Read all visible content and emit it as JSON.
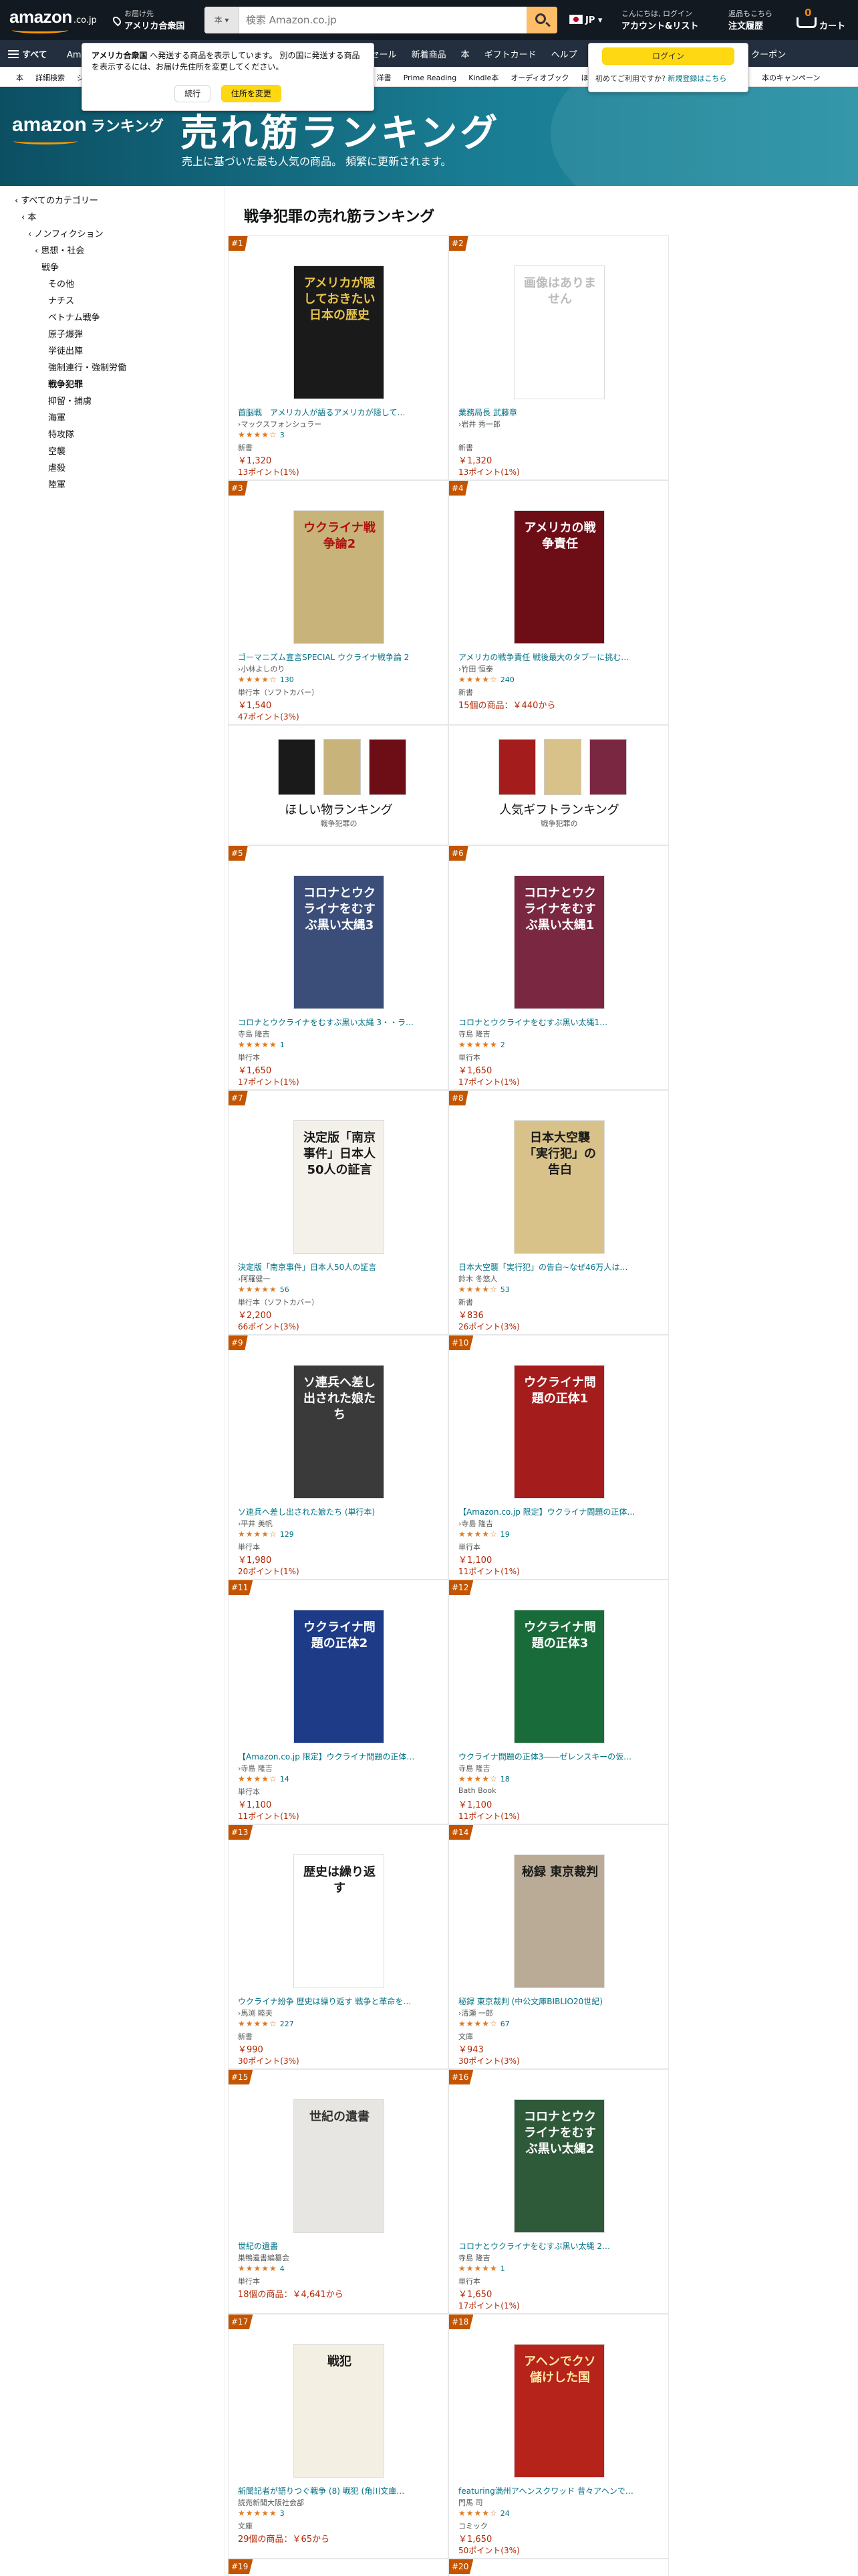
{
  "nav": {
    "logo": "amazon",
    "tld": ".co.jp",
    "deliver_line1": "お届け先",
    "deliver_line2": "アメリカ合衆国",
    "search_category": "本",
    "search_placeholder": "検索 Amazon.co.jp",
    "lang": "JP",
    "account_line1": "こんにちは, ログイン",
    "account_line2": "アカウント&リスト",
    "orders_line1": "返品もこちら",
    "orders_line2": "注文履歴",
    "cart_count": "0",
    "cart_label": "カート"
  },
  "subnav": {
    "all_label": "すべて",
    "links": [
      "Amazonファッション",
      "Prime Video",
      "ベストセラー",
      "Basics",
      "タイムセール",
      "新着商品",
      "本",
      "ギフトカード",
      "ヘルプ",
      "カスタマーサービス",
      "ミュージック",
      "クーポン"
    ]
  },
  "catnav": {
    "items": [
      "本",
      "詳細検索",
      "ジャンル一覧",
      "新刊・予約",
      "Amazonランキング",
      "コミック",
      "雑誌",
      "文庫・新書",
      "洋書",
      "Prime Reading",
      "Kindle本",
      "オーディオブック",
      "ほしい物リスト"
    ],
    "right": "本のキャンペーン"
  },
  "popover": {
    "msg_bold": "アメリカ合衆国",
    "msg_rest": " へ発送する商品を表示しています。 別の国に発送する商品を表示するには、お届け先住所を変更してください。",
    "keep_label": "続行",
    "change_label": "住所を変更"
  },
  "login_popover": {
    "button": "ログイン",
    "hint_text": "初めてご利用ですか? ",
    "hint_link": "新規登録はこちら"
  },
  "banner": {
    "logo": "amazon",
    "ranking_word": "ランキング",
    "title": "売れ筋ランキング",
    "subtitle": "売上に基づいた最も人気の商品。 頻繁に更新されます。"
  },
  "sidebar": {
    "items": [
      {
        "label": "‹ すべてのカテゴリー",
        "level": 0
      },
      {
        "label": "‹ 本",
        "level": 1
      },
      {
        "label": "‹ ノンフィクション",
        "level": 2
      },
      {
        "label": "‹ 思想・社会",
        "level": 3
      },
      {
        "label": "戦争",
        "level": 4
      },
      {
        "label": "その他",
        "level": 5
      },
      {
        "label": "ナチス",
        "level": 5
      },
      {
        "label": "ベトナム戦争",
        "level": 5
      },
      {
        "label": "原子爆弾",
        "level": 5
      },
      {
        "label": "学徒出陣",
        "level": 5
      },
      {
        "label": "強制連行・強制労働",
        "level": 5
      },
      {
        "label": "戦争犯罪",
        "level": 5,
        "selected": true
      },
      {
        "label": "抑留・捕虜",
        "level": 5
      },
      {
        "label": "海軍",
        "level": 5
      },
      {
        "label": "特攻隊",
        "level": 5
      },
      {
        "label": "空襲",
        "level": 5
      },
      {
        "label": "虐殺",
        "level": 5
      },
      {
        "label": "陸軍",
        "level": 5
      }
    ]
  },
  "page_title": "戦争犯罪の売れ筋ランキング",
  "products": [
    {
      "rank": "#1",
      "title": "首脳戦　アメリカ人が語るアメリカが隠して…",
      "author": "›マックスフォンシュラー",
      "stars": "★★★★☆",
      "reviews": "3",
      "format": "新書",
      "price": "￥1,320",
      "points": "13ポイント(1%)",
      "cover_bg": "#1a1a1a",
      "cover_text": "アメリカが隠しておきたい日本の歴史",
      "cover_fg": "#e8c24a"
    },
    {
      "rank": "#2",
      "title": "業務局長 武藤章",
      "author": "›岩井 秀一郎",
      "stars": "",
      "reviews": "",
      "format": "新書",
      "price": "￥1,320",
      "points": "13ポイント(1%)",
      "cover_bg": "#ffffff",
      "cover_text": "画像はありません",
      "cover_fg": "#bbbbbb"
    },
    {
      "rank": "#3",
      "title": "ゴーマニズム宣言SPECIAL ウクライナ戦争論 2",
      "author": "›小林よしのり",
      "stars": "★★★★☆",
      "reviews": "130",
      "format": "単行本（ソフトカバー）",
      "price": "￥1,540",
      "points": "47ポイント(3%)",
      "cover_bg": "#c8b47a",
      "cover_text": "ウクライナ戦争論2",
      "cover_fg": "#b01010"
    },
    {
      "rank": "#4",
      "title": "アメリカの戦争責任 戦後最大のタブーに挑む…",
      "author": "›竹田 恒泰",
      "stars": "★★★★☆",
      "reviews": "240",
      "format": "新書",
      "price": "15個の商品：￥440から",
      "points": "",
      "cover_bg": "#6d0d16",
      "cover_text": "アメリカの戦争責任",
      "cover_fg": "#ffffff"
    },
    {
      "rank": "#5",
      "title": "コロナとウクライナをむすぶ黒い太縄 3・・ラ…",
      "author": "寺島 隆吉",
      "stars": "★★★★★",
      "reviews": "1",
      "format": "単行本",
      "price": "￥1,650",
      "points": "17ポイント(1%)",
      "cover_bg": "#3b4e7a",
      "cover_text": "コロナとウクライナをむすぶ黒い太縄3",
      "cover_fg": "#ffffff"
    },
    {
      "rank": "#6",
      "title": "コロナとウクライナをむすぶ黒い太縄1…",
      "author": "寺島 隆吉",
      "stars": "★★★★★",
      "reviews": "2",
      "format": "単行本",
      "price": "￥1,650",
      "points": "17ポイント(1%)",
      "cover_bg": "#7a2742",
      "cover_text": "コロナとウクライナをむすぶ黒い太縄1",
      "cover_fg": "#ffffff"
    },
    {
      "rank": "#7",
      "title": "決定版「南京事件」日本人50人の証言",
      "author": "›阿羅健一",
      "stars": "★★★★★",
      "reviews": "56",
      "format": "単行本（ソフトカバー）",
      "price": "￥2,200",
      "points": "66ポイント(3%)",
      "cover_bg": "#f4f1ea",
      "cover_text": "決定版「南京事件」日本人50人の証言",
      "cover_fg": "#1a1a1a"
    },
    {
      "rank": "#8",
      "title": "日本大空襲「実行犯」の告白~なぜ46万人は…",
      "author": "鈴木 冬悠人",
      "stars": "★★★★☆",
      "reviews": "53",
      "format": "新書",
      "price": "￥836",
      "points": "26ポイント(3%)",
      "cover_bg": "#d9c28a",
      "cover_text": "日本大空襲「実行犯」の告白",
      "cover_fg": "#1a1a1a"
    },
    {
      "rank": "#9",
      "title": "ソ連兵へ差し出された娘たち (単行本)",
      "author": "›平井 美帆",
      "stars": "★★★★☆",
      "reviews": "129",
      "format": "単行本",
      "price": "￥1,980",
      "points": "20ポイント(1%)",
      "cover_bg": "#3a3a3a",
      "cover_text": "ソ連兵へ差し出された娘たち",
      "cover_fg": "#ffffff"
    },
    {
      "rank": "#10",
      "title": "【Amazon.co.jp 限定】ウクライナ問題の正体…",
      "author": "›寺島 隆吉",
      "stars": "★★★★☆",
      "reviews": "19",
      "format": "単行本",
      "price": "￥1,100",
      "points": "11ポイント(1%)",
      "cover_bg": "#a51c1c",
      "cover_text": "ウクライナ問題の正体1",
      "cover_fg": "#ffffff"
    },
    {
      "rank": "#11",
      "title": "【Amazon.co.jp 限定】ウクライナ問題の正体…",
      "author": "›寺島 隆吉",
      "stars": "★★★★☆",
      "reviews": "14",
      "format": "単行本",
      "price": "￥1,100",
      "points": "11ポイント(1%)",
      "cover_bg": "#1d3b86",
      "cover_text": "ウクライナ問題の正体2",
      "cover_fg": "#ffffff"
    },
    {
      "rank": "#12",
      "title": "ウクライナ問題の正体3――ゼレンスキーの仮…",
      "author": "寺島 隆吉",
      "stars": "★★★★☆",
      "reviews": "18",
      "format": "Bath Book",
      "price": "￥1,100",
      "points": "11ポイント(1%)",
      "cover_bg": "#1a6b3a",
      "cover_text": "ウクライナ問題の正体3",
      "cover_fg": "#ffffff"
    },
    {
      "rank": "#13",
      "title": "ウクライナ紛争 歴史は繰り返す 戦争と革命を…",
      "author": "›馬渕 睦夫",
      "stars": "★★★★☆",
      "reviews": "227",
      "format": "新書",
      "price": "￥990",
      "points": "30ポイント(3%)",
      "cover_bg": "#ffffff",
      "cover_text": "歴史は繰り返す",
      "cover_fg": "#1a1a1a"
    },
    {
      "rank": "#14",
      "title": "秘録 東京裁判 (中公文庫BIBLIO20世紀)",
      "author": "›清瀬 一郎",
      "stars": "★★★★☆",
      "reviews": "67",
      "format": "文庫",
      "price": "￥943",
      "points": "30ポイント(3%)",
      "cover_bg": "#b9ab95",
      "cover_text": "秘録 東京裁判",
      "cover_fg": "#1a1a1a"
    },
    {
      "rank": "#15",
      "title": "世紀の遺書",
      "author": "巣鴨遺書編纂会",
      "stars": "★★★★★",
      "reviews": "4",
      "format": "単行本",
      "price": "18個の商品：￥4,641から",
      "points": "",
      "cover_bg": "#e8e6e2",
      "cover_text": "世紀の遺書",
      "cover_fg": "#333333"
    },
    {
      "rank": "#16",
      "title": "コロナとウクライナをむすぶ黒い太縄 2…",
      "author": "寺島 隆吉",
      "stars": "★★★★★",
      "reviews": "1",
      "format": "単行本",
      "price": "￥1,650",
      "points": "17ポイント(1%)",
      "cover_bg": "#2f5a3a",
      "cover_text": "コロナとウクライナをむすぶ黒い太縄2",
      "cover_fg": "#ffffff"
    },
    {
      "rank": "#17",
      "title": "新聞記者が語りつぐ戦争 (8) 戦犯 (角川文庫…",
      "author": "読売新聞大阪社会部",
      "stars": "★★★★★",
      "reviews": "3",
      "format": "文庫",
      "price": "29個の商品：￥65から",
      "points": "",
      "cover_bg": "#f3efe2",
      "cover_text": "戦犯",
      "cover_fg": "#1a1a1a"
    },
    {
      "rank": "#18",
      "title": "featuring満州アヘンスクワッド 昔々アヘンで…",
      "author": "門馬 司",
      "stars": "★★★★☆",
      "reviews": "24",
      "format": "コミック",
      "price": "￥1,650",
      "points": "50ポイント(3%)",
      "cover_bg": "#b5231b",
      "cover_text": "アヘンでクソ儲けした国",
      "cover_fg": "#ffe9a0"
    }
  ],
  "promos": [
    {
      "title": "ほしい物ランキング",
      "sub": "戦争犯罪の"
    },
    {
      "title": "人気ギフトランキング",
      "sub": "戦争犯罪の"
    }
  ],
  "more_ranks": [
    "#19",
    "#20"
  ]
}
